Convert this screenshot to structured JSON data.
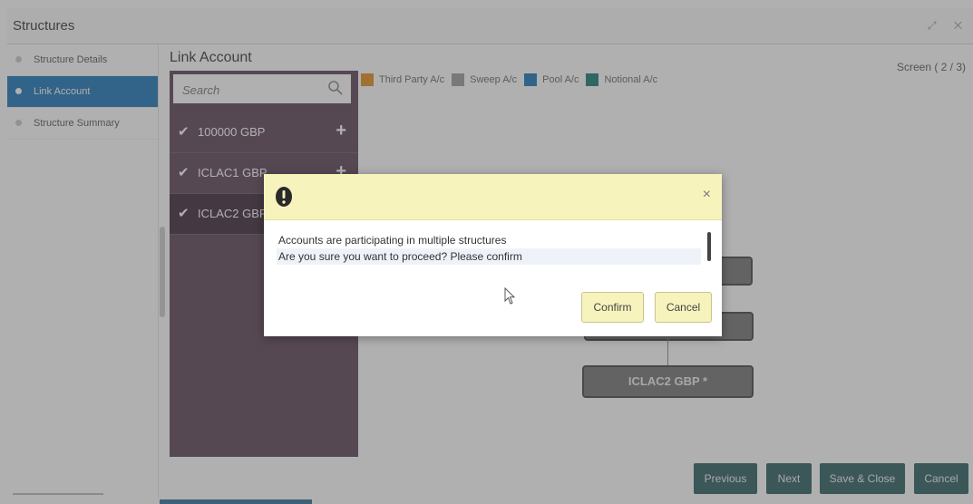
{
  "app": {
    "title": "Structures"
  },
  "header": {
    "window_icons": "⤢ ✕"
  },
  "nav": {
    "items": [
      {
        "label": "Structure Details",
        "active": false
      },
      {
        "label": "Link Account",
        "active": true
      },
      {
        "label": "Structure Summary",
        "active": false
      }
    ]
  },
  "main": {
    "section_title": "Link Account",
    "screen_indicator": "Screen ( 2 / 3)",
    "legend": [
      {
        "label": "Third Party A/c",
        "color": "#e48a1c"
      },
      {
        "label": "Sweep A/c",
        "color": "#9b9b9b"
      },
      {
        "label": "Pool A/c",
        "color": "#1b74b6"
      },
      {
        "label": "Notional A/c",
        "color": "#177a78"
      }
    ],
    "search": {
      "placeholder": "Search",
      "icon": "search-icon"
    },
    "accounts": [
      {
        "name": "100000 GBP",
        "checked": true,
        "action": "+"
      },
      {
        "name": "ICLAC1 GBP",
        "checked": true,
        "action": "+"
      },
      {
        "name": "ICLAC2 GBP",
        "checked": true,
        "action": ""
      }
    ],
    "diagram": {
      "nodes": [
        {
          "label": ""
        },
        {
          "label": ""
        },
        {
          "label": "ICLAC2 GBP *"
        }
      ]
    }
  },
  "dialog": {
    "icon": "warning-icon",
    "close": "×",
    "line1": "Accounts are participating in multiple structures",
    "line2": "Are you sure you want to proceed? Please confirm",
    "confirm_label": "Confirm",
    "cancel_label": "Cancel"
  },
  "footer": {
    "previous": "Previous",
    "next": "Next",
    "save_close": "Save & Close",
    "cancel": "Cancel"
  },
  "colors": {
    "nav_active": "#1b74b6",
    "account_panel": "#5b4257",
    "footer_button": "#2d5d5f",
    "dialog_header": "#f6f3bd"
  }
}
